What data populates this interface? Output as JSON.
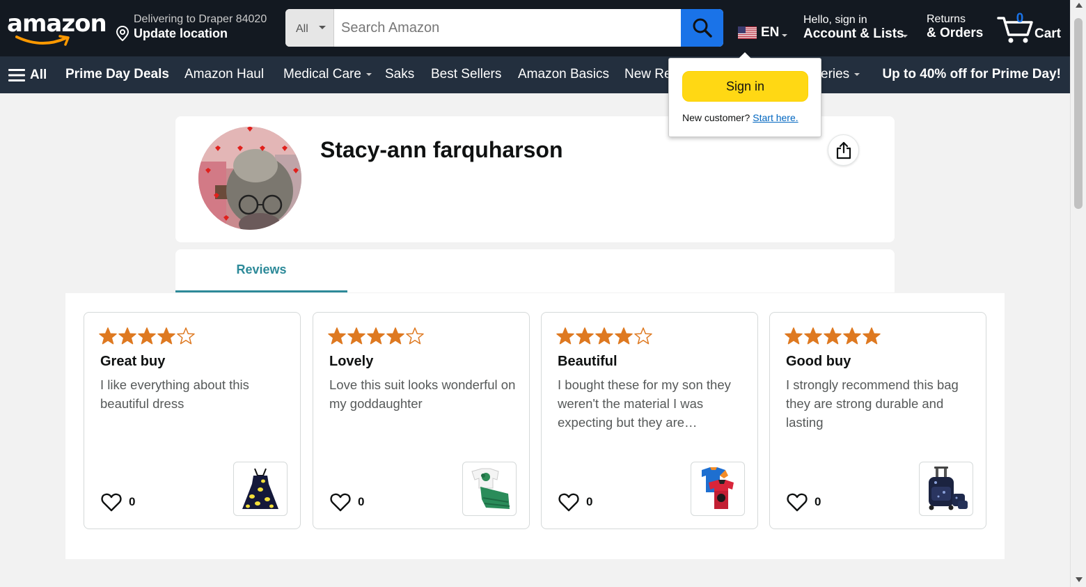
{
  "header": {
    "logo_text": "amazon",
    "delivery_line1": "Delivering to Draper 84020",
    "delivery_line2": "Update location",
    "search_category": "All",
    "search_placeholder": "Search Amazon",
    "language": "EN",
    "account_line1": "Hello, sign in",
    "account_line2": "Account & Lists",
    "returns_line1": "Returns",
    "returns_line2": "& Orders",
    "cart_count": "0",
    "cart_label": "Cart"
  },
  "nav": {
    "all_label": "All",
    "items": [
      {
        "label": "Prime Day Deals"
      },
      {
        "label": "Amazon Haul"
      },
      {
        "label": "Medical Care"
      },
      {
        "label": "Saks"
      },
      {
        "label": "Best Sellers"
      },
      {
        "label": "Amazon Basics"
      },
      {
        "label": "New Re"
      },
      {
        "label": "eries"
      }
    ],
    "promo": "Up to 40% off for Prime Day!"
  },
  "flyout": {
    "signin_label": "Sign in",
    "new_customer": "New customer?",
    "start_here": "Start here."
  },
  "profile": {
    "name": "Stacy-ann farquharson"
  },
  "tabs": {
    "reviews": "Reviews"
  },
  "reviews": [
    {
      "rating": 4,
      "title": "Great buy",
      "body": "I like everything about this beautiful dress",
      "likes": "0",
      "product_icon": "lemon-dress-thumbnail"
    },
    {
      "rating": 4,
      "title": "Lovely",
      "body": "Love this suit looks wonderful on my goddaughter",
      "likes": "0",
      "product_icon": "green-skirt-outfit-thumbnail"
    },
    {
      "rating": 4,
      "title": "Beautiful",
      "body": "I bought these for my son they weren't the material I was expecting but they are…",
      "likes": "0",
      "product_icon": "boys-tshirts-thumbnail"
    },
    {
      "rating": 5,
      "title": "Good buy",
      "body": "I strongly recommend this bag they are strong durable and lasting",
      "likes": "0",
      "product_icon": "rolling-backpack-thumbnail"
    }
  ],
  "colors": {
    "nav_dark": "#131921",
    "nav_secondary": "#232f3e",
    "search_button": "#1a73e8",
    "star": "#de7921",
    "signin_button": "#ffd814",
    "tab_accent": "#2d8a99",
    "link": "#0066c0"
  }
}
